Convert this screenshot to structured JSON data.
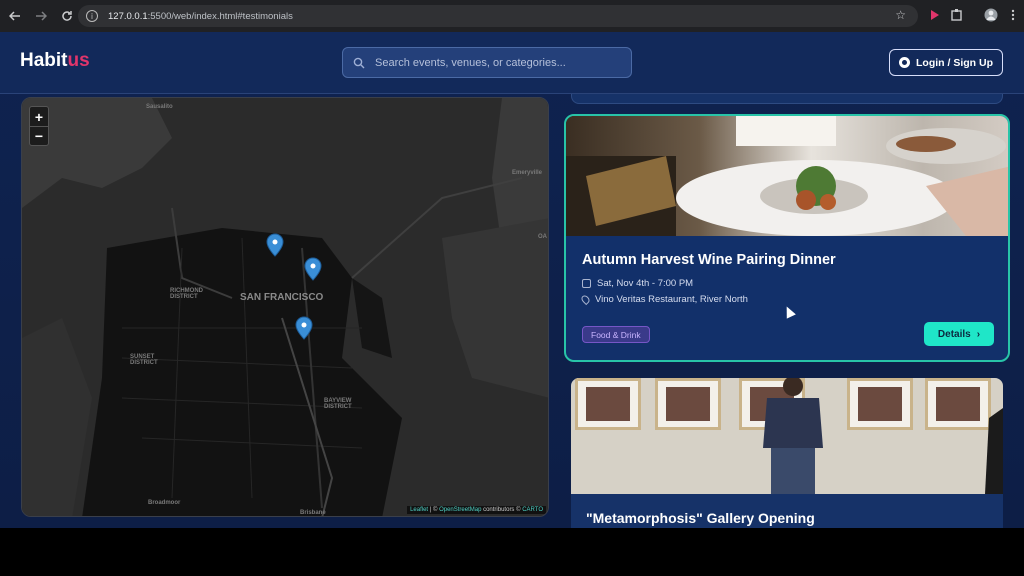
{
  "browser": {
    "url_host": "127.0.0.1",
    "url_rest": ":5500/web/index.html#testimonials"
  },
  "header": {
    "logo_main": "Habit",
    "logo_accent": "us",
    "search_placeholder": "Search events, venues, or categories...",
    "login_label": "Login / Sign Up"
  },
  "map": {
    "zoom_in": "+",
    "zoom_out": "−",
    "labels": {
      "sausalito": "Sausalito",
      "emeryville": "Emeryville",
      "oakland": "OA",
      "san_francisco": "SAN FRANCISCO",
      "richmond": "RICHMOND DISTRICT",
      "sunset": "SUNSET DISTRICT",
      "bayview": "BAYVIEW DISTRICT",
      "broadmoor": "Broadmoor",
      "brisbane": "Brisbane"
    },
    "attribution": {
      "leaflet": "Leaflet",
      "sep1": " | © ",
      "osm": "OpenStreetMap",
      "sep2": " contributors © ",
      "carto": "CARTO"
    }
  },
  "events": {
    "featured": {
      "title": "Autumn Harvest Wine Pairing Dinner",
      "date": "Sat, Nov 4th - 7:00 PM",
      "venue": "Vino Veritas Restaurant, River North",
      "tag": "Food & Drink",
      "details_label": "Details",
      "details_icon": "›"
    },
    "next": {
      "title": "\"Metamorphosis\" Gallery Opening"
    }
  },
  "colors": {
    "accent": "#e0356b",
    "teal": "#1fe6c8",
    "bg": "#0f2350"
  }
}
